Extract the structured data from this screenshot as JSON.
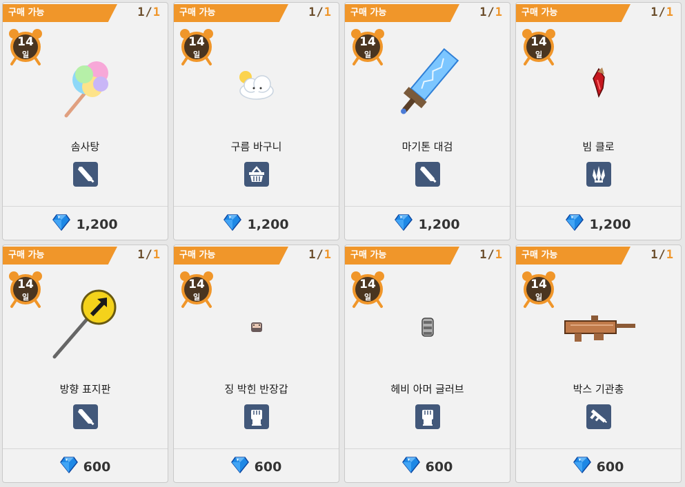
{
  "shop": {
    "items": [
      {
        "badge": "구매 가능",
        "count_current": "1",
        "count_sep": "/",
        "count_max": "1",
        "days": "14",
        "day_unit": "일",
        "name": "솜사탕",
        "type_icon": "sword-icon",
        "price": "1,200",
        "art": "cotton-candy"
      },
      {
        "badge": "구매 가능",
        "count_current": "1",
        "count_sep": "/",
        "count_max": "1",
        "days": "14",
        "day_unit": "일",
        "name": "구름 바구니",
        "type_icon": "basket-icon",
        "price": "1,200",
        "art": "cloud"
      },
      {
        "badge": "구매 가능",
        "count_current": "1",
        "count_sep": "/",
        "count_max": "1",
        "days": "14",
        "day_unit": "일",
        "name": "마기톤 대검",
        "type_icon": "sword-icon",
        "price": "1,200",
        "art": "greatsword"
      },
      {
        "badge": "구매 가능",
        "count_current": "1",
        "count_sep": "/",
        "count_max": "1",
        "days": "14",
        "day_unit": "일",
        "name": "빔 클로",
        "type_icon": "claw-icon",
        "price": "1,200",
        "art": "claw"
      },
      {
        "badge": "구매 가능",
        "count_current": "1",
        "count_sep": "/",
        "count_max": "1",
        "days": "14",
        "day_unit": "일",
        "name": "방향 표지판",
        "type_icon": "sword-icon",
        "price": "600",
        "art": "sign"
      },
      {
        "badge": "구매 가능",
        "count_current": "1",
        "count_sep": "/",
        "count_max": "1",
        "days": "14",
        "day_unit": "일",
        "name": "징 박힌 반장갑",
        "type_icon": "fist-icon",
        "price": "600",
        "art": "glove"
      },
      {
        "badge": "구매 가능",
        "count_current": "1",
        "count_sep": "/",
        "count_max": "1",
        "days": "14",
        "day_unit": "일",
        "name": "헤비 아머 글러브",
        "type_icon": "fist-icon",
        "price": "600",
        "art": "gauntlet"
      },
      {
        "badge": "구매 가능",
        "count_current": "1",
        "count_sep": "/",
        "count_max": "1",
        "days": "14",
        "day_unit": "일",
        "name": "박스 기관총",
        "type_icon": "gun-icon",
        "price": "600",
        "art": "machinegun"
      }
    ]
  },
  "colors": {
    "badge": "#f0962a",
    "count_max": "#f0962a",
    "count_current": "#6b4e2c",
    "clock": "#f0962a",
    "clock_face": "#4a3520",
    "type_icon_bg": "#42587a",
    "price_text": "#333333",
    "gem": "#1e88e5"
  },
  "icons": {
    "currency": "diamond-gem-icon",
    "timer": "alarm-clock-icon"
  }
}
